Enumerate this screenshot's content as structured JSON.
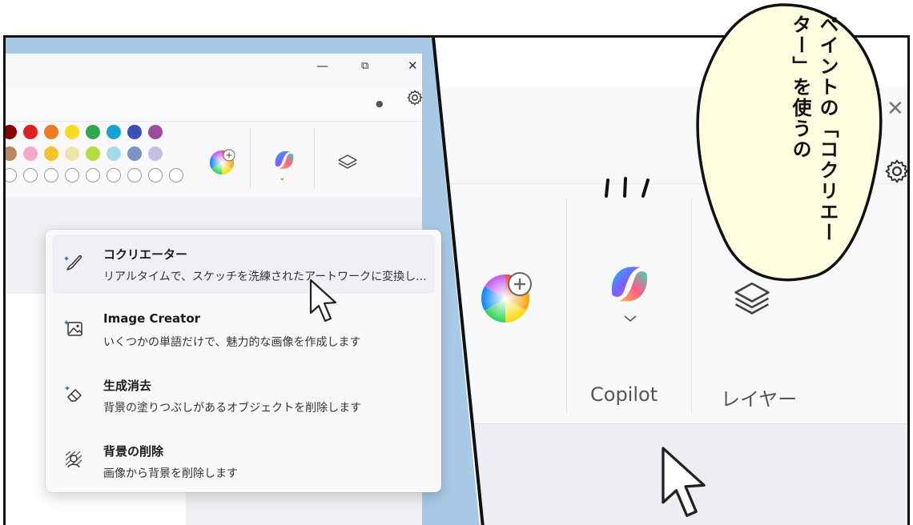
{
  "left_window": {
    "caption": {
      "minimize": "—",
      "maximize": "⧉",
      "close": "✕"
    },
    "palette_row1": [
      "#8b0000",
      "#e02020",
      "#f07a22",
      "#f5dc1f",
      "#2da84a",
      "#14a3d6",
      "#3d4fb5",
      "#9b4ca3"
    ],
    "palette_row2": [
      "#b58a62",
      "#f4a9c8",
      "#f8c12a",
      "#eee3a8",
      "#b7dc3c",
      "#a7dbe8",
      "#7c92c2",
      "#c9bde4"
    ],
    "palette_row3_count": 9
  },
  "dropdown": {
    "items": [
      {
        "icon": "cocreator-brush-icon",
        "title": "コクリエーター",
        "desc": "リアルタイムで、スケッチを洗練されたアートワークに変換し...",
        "selected": true
      },
      {
        "icon": "image-creator-icon",
        "title": "Image Creator",
        "desc": "いくつかの単語だけで、魅力的な画像を作成します",
        "selected": false
      },
      {
        "icon": "generative-erase-icon",
        "title": "生成消去",
        "desc": "背景の塗りつぶしがあるオブジェクトを削除します",
        "selected": false
      },
      {
        "icon": "remove-background-icon",
        "title": "背景の削除",
        "desc": "画像から背景を削除します",
        "selected": false
      }
    ]
  },
  "right_window": {
    "copilot_label": "Copilot",
    "layer_label": "レイヤー",
    "minimize": "—",
    "close": "✕"
  },
  "bubble": {
    "text": "ペイントの「コクリエーター」を使うの"
  },
  "colors": {
    "panel_blue": "#a8c9e6",
    "bubble_fill": "#fffde0"
  }
}
